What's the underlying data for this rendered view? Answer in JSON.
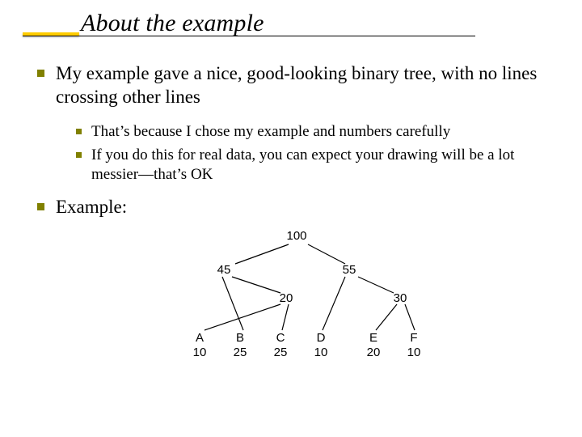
{
  "title": "About the example",
  "bullets": {
    "b1": "My example gave a nice, good-looking binary tree, with no lines crossing other lines",
    "b1_sub1": "That’s because I chose my example and numbers carefully",
    "b1_sub2": "If you do this for real data, you can expect your drawing will be a lot messier—that’s OK",
    "b2": "Example:"
  },
  "diagram": {
    "root": "100",
    "mid_left": "45",
    "mid_right": "55",
    "mid_center": "20",
    "mid_far_right": "30",
    "leaves": {
      "A": {
        "label": "A",
        "value": "10"
      },
      "B": {
        "label": "B",
        "value": "25"
      },
      "C": {
        "label": "C",
        "value": "25"
      },
      "D": {
        "label": "D",
        "value": "10"
      },
      "E": {
        "label": "E",
        "value": "20"
      },
      "F": {
        "label": "F",
        "value": "10"
      }
    }
  }
}
